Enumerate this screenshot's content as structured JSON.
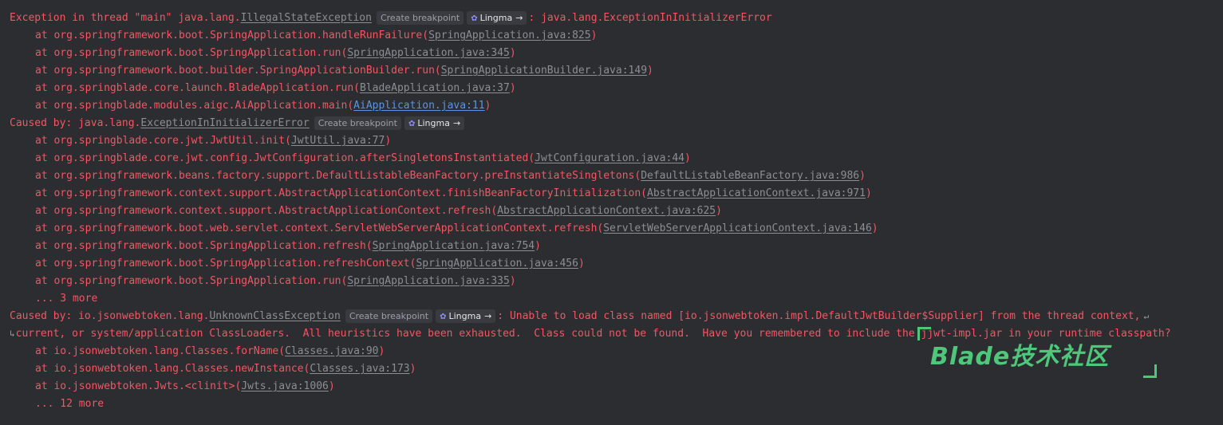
{
  "badges": {
    "create_breakpoint": "Create breakpoint",
    "lingma": "Lingma",
    "lingma_icon": "lingma-logo-icon",
    "arrow_icon": "arrow-right-icon"
  },
  "lines": {
    "l1": {
      "pre": "Exception in thread \"main\" java.lang.",
      "cls": "IllegalStateException",
      "post": ": java.lang.ExceptionInInitializerError"
    },
    "l2": {
      "pre": "at org.springframework.boot.SpringApplication.handleRunFailure(",
      "link": "SpringApplication.java:825",
      "post": ")"
    },
    "l3": {
      "pre": "at org.springframework.boot.SpringApplication.run(",
      "link": "SpringApplication.java:345",
      "post": ")"
    },
    "l4": {
      "pre": "at org.springframework.boot.builder.SpringApplicationBuilder.run(",
      "link": "SpringApplicationBuilder.java:149",
      "post": ")"
    },
    "l5": {
      "pre": "at org.springblade.core.launch.BladeApplication.run(",
      "link": "BladeApplication.java:37",
      "post": ")"
    },
    "l6": {
      "pre": "at org.springblade.modules.aigc.AiApplication.main(",
      "link": "AiApplication.java:11",
      "post": ")"
    },
    "l7": {
      "pre": "Caused by: java.lang.",
      "cls": "ExceptionInInitializerError"
    },
    "l8": {
      "pre": "at org.springblade.core.jwt.JwtUtil.init(",
      "link": "JwtUtil.java:77",
      "post": ")"
    },
    "l9": {
      "pre": "at org.springblade.core.jwt.config.JwtConfiguration.afterSingletonsInstantiated(",
      "link": "JwtConfiguration.java:44",
      "post": ")"
    },
    "l10": {
      "pre": "at org.springframework.beans.factory.support.DefaultListableBeanFactory.preInstantiateSingletons(",
      "link": "DefaultListableBeanFactory.java:986",
      "post": ")"
    },
    "l11": {
      "pre": "at org.springframework.context.support.AbstractApplicationContext.finishBeanFactoryInitialization(",
      "link": "AbstractApplicationContext.java:971",
      "post": ")"
    },
    "l12": {
      "pre": "at org.springframework.context.support.AbstractApplicationContext.refresh(",
      "link": "AbstractApplicationContext.java:625",
      "post": ")"
    },
    "l13": {
      "pre": "at org.springframework.boot.web.servlet.context.ServletWebServerApplicationContext.refresh(",
      "link": "ServletWebServerApplicationContext.java:146",
      "post": ")"
    },
    "l14": {
      "pre": "at org.springframework.boot.SpringApplication.refresh(",
      "link": "SpringApplication.java:754",
      "post": ")"
    },
    "l15": {
      "pre": "at org.springframework.boot.SpringApplication.refreshContext(",
      "link": "SpringApplication.java:456",
      "post": ")"
    },
    "l16": {
      "pre": "at org.springframework.boot.SpringApplication.run(",
      "link": "SpringApplication.java:335",
      "post": ")"
    },
    "l17": {
      "text": "... 3 more"
    },
    "l18": {
      "pre": "Caused by: io.jsonwebtoken.lang.",
      "cls": "UnknownClassException",
      "post": ": Unable to load class named [io.jsonwebtoken.impl.DefaultJwtBuilder$Supplier] from the thread context,"
    },
    "l19": {
      "text": "current, or system/application ClassLoaders.  All heuristics have been exhausted.  Class could not be found.  Have you remembered to include the jjwt-impl.jar in your runtime classpath?"
    },
    "l20": {
      "pre": "at io.jsonwebtoken.lang.Classes.forName(",
      "link": "Classes.java:90",
      "post": ")"
    },
    "l21": {
      "pre": "at io.jsonwebtoken.lang.Classes.newInstance(",
      "link": "Classes.java:173",
      "post": ")"
    },
    "l22": {
      "pre": "at io.jsonwebtoken.Jwts.<clinit>(",
      "link": "Jwts.java:1006",
      "post": ")"
    },
    "l23": {
      "text": "... 12 more"
    }
  },
  "watermark": {
    "text": "Blade技术社区"
  },
  "colors": {
    "background": "#2b2d30",
    "error": "#f75464",
    "link_muted": "#8b8e94",
    "link_blue": "#5a94e6",
    "watermark": "#4fc77a"
  }
}
